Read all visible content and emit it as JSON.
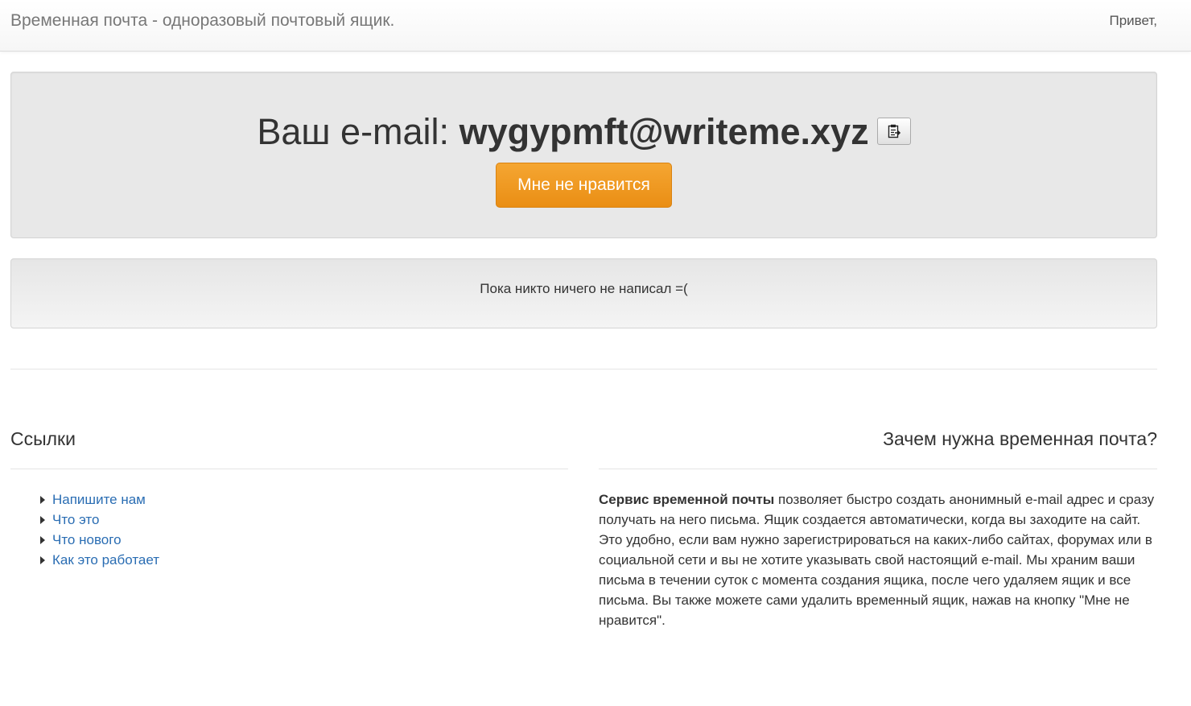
{
  "header": {
    "brand": "Временная почта - одноразовый почтовый ящик.",
    "greeting": "Привет,"
  },
  "hero": {
    "email_prefix": "Ваш e-mail: ",
    "email_address": "wygypmft@writeme.xyz",
    "copy_icon": "clipboard-icon",
    "dislike_button_label": "Мне не нравится",
    "accent_color": "#ef961f"
  },
  "inbox": {
    "empty_message": "Пока никто ничего не написал =("
  },
  "links": {
    "title": "Ссылки",
    "items": [
      {
        "label": "Напишите нам"
      },
      {
        "label": "Что это"
      },
      {
        "label": "Что нового"
      },
      {
        "label": "Как это работает"
      }
    ],
    "link_color": "#2a6db3"
  },
  "about": {
    "title": "Зачем нужна временная почта?",
    "lead": "Сервис временной почты",
    "body": " позволяет быстро создать анонимный e-mail адрес и сразу получать на него письма. Ящик создается автоматически, когда вы заходите на сайт. Это удобно, если вам нужно зарегистрироваться на каких-либо сайтах, форумах или в социальной сети и вы не хотите указывать свой настоящий e-mail. Мы храним ваши письма в течении суток с момента создания ящика, после чего удаляем ящик и все письма. Вы также можете сами удалить временный ящик, нажав на кнопку \"Мне не нравится\"."
  }
}
